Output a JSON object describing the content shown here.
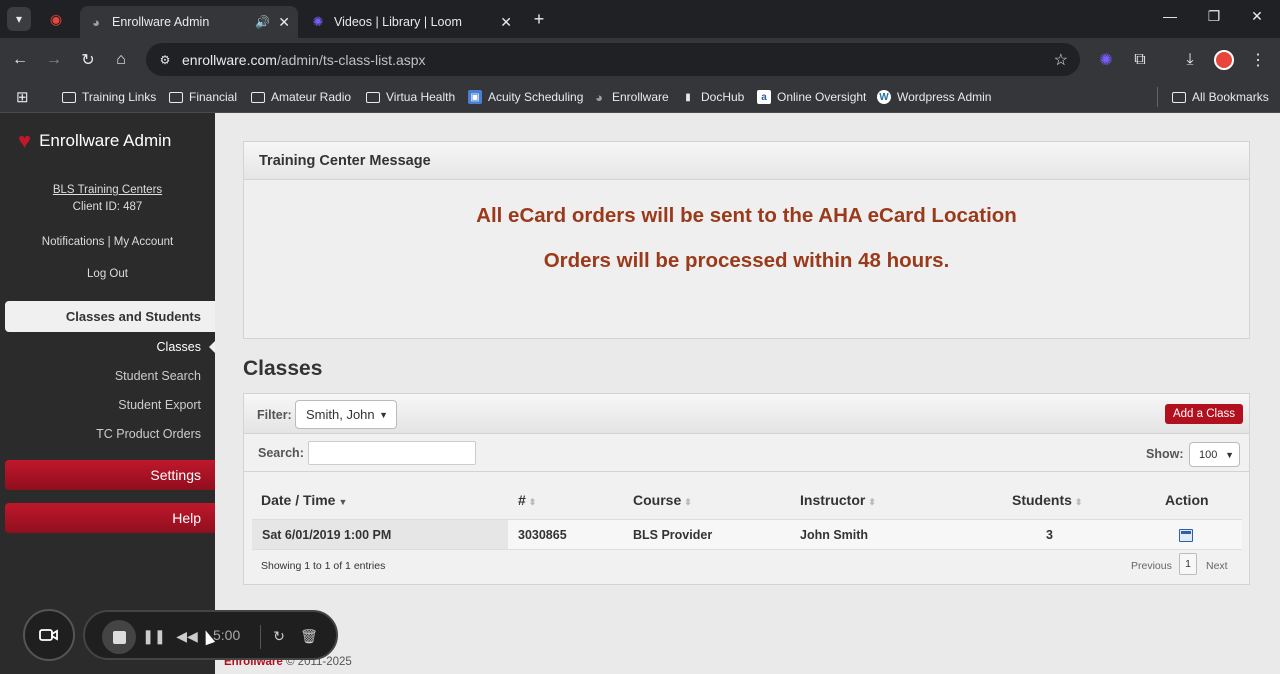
{
  "browser": {
    "tabs": [
      {
        "title": "Enrollware Admin",
        "audio_icon": "speaker-icon"
      },
      {
        "title": "Videos | Library | Loom"
      }
    ],
    "url_domain": "enrollware.com",
    "url_path": "/admin/ts-class-list.aspx",
    "bookmarks": [
      "Training Links",
      "Financial",
      "Amateur Radio",
      "Virtua Health",
      "Acuity Scheduling",
      "Enrollware",
      "DocHub",
      "Online Oversight",
      "Wordpress Admin"
    ],
    "all_bookmarks": "All Bookmarks"
  },
  "sidebar": {
    "brand": "Enrollware Admin",
    "org_name": "BLS Training Centers",
    "client_id": "Client ID: 487",
    "account_links": "Notifications | My Account",
    "logout": "Log Out",
    "section": "Classes and Students",
    "items": [
      "Classes",
      "Student Search",
      "Student Export",
      "TC Product Orders"
    ],
    "settings": "Settings",
    "help": "Help"
  },
  "message_panel": {
    "title": "Training Center Message",
    "line1": "All eCard orders will be sent to the AHA eCard Location",
    "line2": "Orders will be processed within 48 hours."
  },
  "classes": {
    "heading": "Classes",
    "filter_label": "Filter:",
    "filter_value": "Smith, John",
    "add_button": "Add a Class",
    "search_label": "Search:",
    "show_label": "Show:",
    "show_value": "100",
    "columns": [
      "Date / Time",
      "#",
      "Course",
      "Instructor",
      "Students",
      "Action"
    ],
    "rows": [
      {
        "date": "Sat 6/01/2019 1:00 PM",
        "number": "3030865",
        "course": "BLS Provider",
        "instructor": "John Smith",
        "students": "3"
      }
    ],
    "info": "Showing 1 to 1 of 1 entries",
    "previous": "Previous",
    "page": "1",
    "next": "Next"
  },
  "footer": {
    "brand": "Enrollware",
    "copyright": " © 2011-2025"
  },
  "recorder": {
    "time": "5:00"
  }
}
